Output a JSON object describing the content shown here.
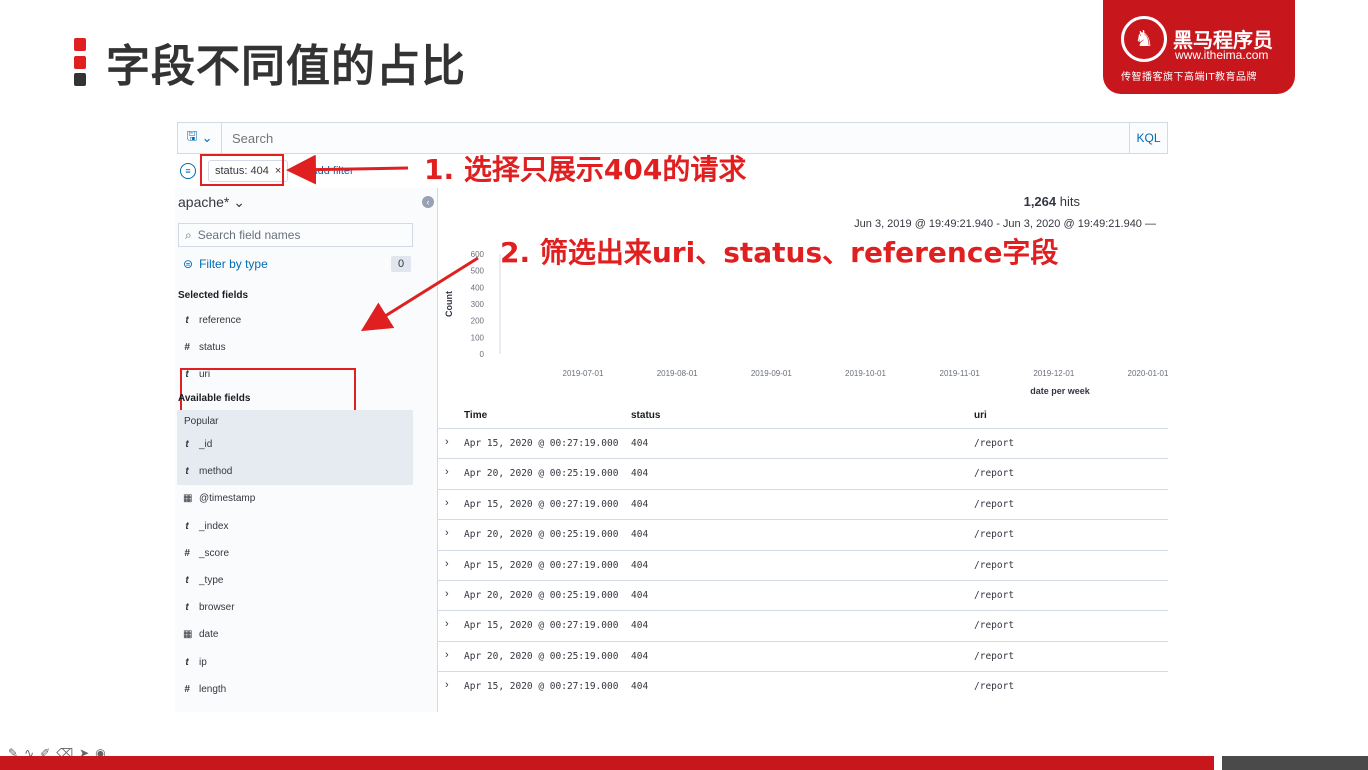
{
  "slide": {
    "title": "字段不同值的占比",
    "logo_name": "黑马程序员",
    "logo_url": "www.itheima.com",
    "logo_slogan": "传智播客旗下高端IT教育品牌"
  },
  "kibana": {
    "search_placeholder": "Search",
    "kql_label": "KQL",
    "filter_pill": "status: 404",
    "filter_pill_close": "×",
    "add_filter": "Add filter",
    "index_pattern": "apache*",
    "field_search_placeholder": "Search field names",
    "filter_by_type": "Filter by type",
    "filter_count": "0",
    "selected_fields_title": "Selected fields",
    "selected_fields": [
      {
        "type": "t",
        "name": "reference"
      },
      {
        "type": "#",
        "name": "status"
      },
      {
        "type": "t",
        "name": "uri"
      }
    ],
    "available_fields_title": "Available fields",
    "popular_label": "Popular",
    "available_fields": [
      {
        "type": "t",
        "name": "_id"
      },
      {
        "type": "t",
        "name": "method"
      },
      {
        "type": "cal",
        "name": "@timestamp"
      },
      {
        "type": "t",
        "name": "_index"
      },
      {
        "type": "#",
        "name": "_score"
      },
      {
        "type": "t",
        "name": "_type"
      },
      {
        "type": "t",
        "name": "browser"
      },
      {
        "type": "cal",
        "name": "date"
      },
      {
        "type": "t",
        "name": "ip"
      },
      {
        "type": "#",
        "name": "length"
      }
    ],
    "hits_count": "1,264",
    "hits_label": "hits",
    "date_range": "Jun 3, 2019 @ 19:49:21.940 - Jun 3, 2020 @ 19:49:21.940 —",
    "table_headers": {
      "time": "Time",
      "status": "status",
      "uri": "uri"
    },
    "rows": [
      {
        "time": "Apr 15, 2020 @ 00:27:19.000",
        "status": "404",
        "uri": "/report"
      },
      {
        "time": "Apr 20, 2020 @ 00:25:19.000",
        "status": "404",
        "uri": "/report"
      },
      {
        "time": "Apr 15, 2020 @ 00:27:19.000",
        "status": "404",
        "uri": "/report"
      },
      {
        "time": "Apr 20, 2020 @ 00:25:19.000",
        "status": "404",
        "uri": "/report"
      },
      {
        "time": "Apr 15, 2020 @ 00:27:19.000",
        "status": "404",
        "uri": "/report"
      },
      {
        "time": "Apr 20, 2020 @ 00:25:19.000",
        "status": "404",
        "uri": "/report"
      },
      {
        "time": "Apr 15, 2020 @ 00:27:19.000",
        "status": "404",
        "uri": "/report"
      },
      {
        "time": "Apr 20, 2020 @ 00:25:19.000",
        "status": "404",
        "uri": "/report"
      },
      {
        "time": "Apr 15, 2020 @ 00:27:19.000",
        "status": "404",
        "uri": "/report"
      }
    ]
  },
  "chart_data": {
    "type": "bar",
    "ylabel": "Count",
    "xlabel": "date per week",
    "ylim": [
      0,
      600
    ],
    "y_ticks": [
      0,
      100,
      200,
      300,
      400,
      500,
      600
    ],
    "x_ticks": [
      "2019-07-01",
      "2019-08-01",
      "2019-09-01",
      "2019-10-01",
      "2019-11-01",
      "2019-12-01",
      "2020-01-01"
    ],
    "values": []
  },
  "annotations": {
    "step1": "1. 选择只展示404的请求",
    "step2": "2. 筛选出来uri、status、reference字段"
  },
  "colors": {
    "accent": "#e02020",
    "brand": "#c8161d",
    "link": "#006bb4"
  }
}
